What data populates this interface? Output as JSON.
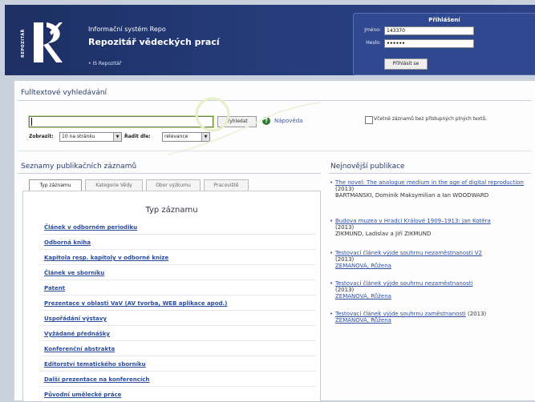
{
  "header": {
    "vertical_label": "REPOZITÁŘ",
    "system_name": "Informační systém Repo",
    "title": "Repozitář vědeckých prací",
    "breadcrumb": "• IS Repozitář"
  },
  "login": {
    "title": "Přihlášení",
    "username_label": "Jméno:",
    "username_value": "143370",
    "password_label": "Heslo:",
    "password_value": "••••••",
    "submit_label": "Přihlásit se"
  },
  "fulltext": {
    "heading": "Fulltextové vyhledávání",
    "search_value": "",
    "search_button": "Vyhledat",
    "help_icon": "?",
    "help_link": "Nápověda",
    "checkbox_label": "Včetně záznamů bez přístupných plných textů.",
    "show_label": "Zobrazit:",
    "show_value": "10 na stránku",
    "sort_label": "Řadit dle:",
    "sort_value": "relevance"
  },
  "lists": {
    "heading": "Seznamy publikačních záznamů",
    "tabs": [
      "Typ záznamu",
      "Kategorie Vědy",
      "Obor výzkumu",
      "Pracoviště"
    ],
    "active_tab": 0,
    "box_title": "Typ záznamu",
    "items": [
      "Článek v odborném periodiku",
      "Odborná kniha",
      "Kapitola resp. kapitoly v odborné knize",
      "Článek ve sborníku",
      "Patent",
      "Prezentace v oblasti VaV (AV tvorba, WEB aplikace apod.)",
      "Uspořádání výstavy",
      "Vyžádané přednášky",
      "Konferenční abstrakta",
      "Editorství tematického sborníku",
      "Další prezentace na konferencích",
      "Původní umělecké práce"
    ]
  },
  "newest": {
    "heading": "Nejnovější publikace",
    "bullet": "•",
    "items": [
      {
        "title": "The novel: The analogue medium in the age of digital reproduction",
        "year": "(2013)",
        "authors": "BARTMANSKI, Dominik Maksymilian a Ian WOODWARD",
        "authors_linked": false
      },
      {
        "title": "Budova muzea v Hradci Králové 1909–1913: Jan Kotěra",
        "year": "(2013)",
        "authors": "ZIKMUND, Ladislav a Jiří ZIKMUND",
        "authors_linked": false
      },
      {
        "title": "Testovací článek výjde souhrnu nezaměstnanosti V2",
        "year": "(2013)",
        "authors": "ZEMANOVÁ, Růžena",
        "authors_linked": true
      },
      {
        "title": "Testovací článek výjde souhrnu nezaměstnanosti",
        "year": "(2013)",
        "authors": "ZEMANOVÁ, Růžena",
        "authors_linked": true
      },
      {
        "title": "Testovací článek výjde souhrnu zaměstnanosti",
        "year": "(2013)",
        "authors": "ZEMANOVÁ, Růžena",
        "authors_linked": true
      }
    ]
  },
  "colors": {
    "header_bg": "#1d2f63",
    "login_bg": "#2f4890",
    "link": "#2a4c9c",
    "heading": "#2a3c6e"
  }
}
